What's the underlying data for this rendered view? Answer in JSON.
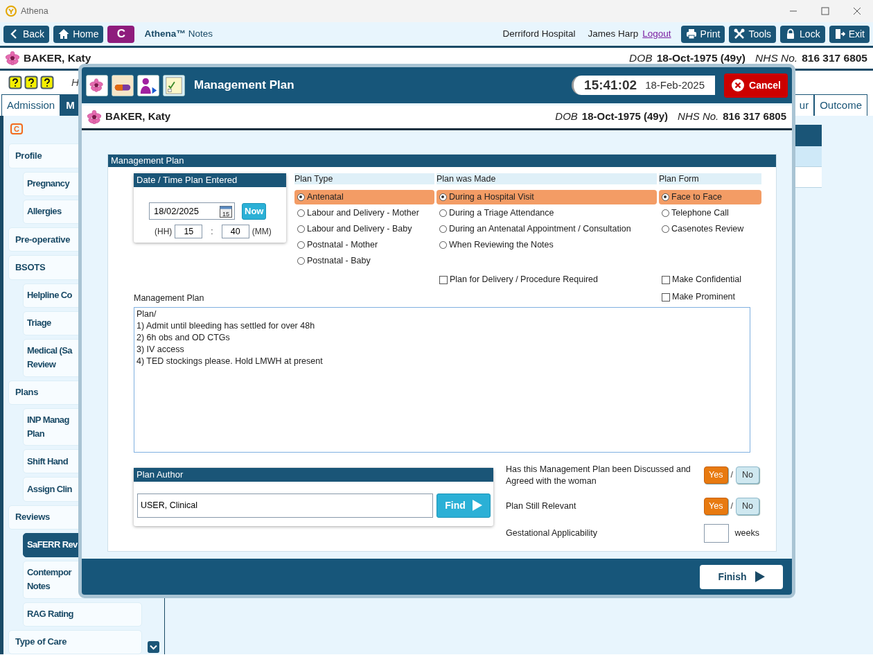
{
  "window": {
    "title": "Athena"
  },
  "toolbar": {
    "left_buttons": [
      {
        "label": "Back"
      },
      {
        "label": "Home"
      }
    ],
    "module_badge": "C",
    "app_name": "Athena™",
    "app_subtitle": "Notes",
    "hospital": "Derriford Hospital",
    "user": "James Harp",
    "logout": "Logout",
    "right_buttons": [
      {
        "label": "Print"
      },
      {
        "label": "Tools"
      },
      {
        "label": "Lock"
      },
      {
        "label": "Exit"
      }
    ]
  },
  "patient": {
    "name": "BAKER, Katy",
    "dob_label": "DOB",
    "dob": "18-Oct-1975 (49y)",
    "nhs_label": "NHS No.",
    "nhs": "816 317 6805"
  },
  "help_row": {
    "text": "H"
  },
  "tabs": [
    {
      "label": "Admission",
      "selected": false
    },
    {
      "label": "M",
      "selected": true
    },
    {
      "label": "ur",
      "selected": false
    },
    {
      "label": "Outcome",
      "selected": false
    }
  ],
  "sidebar": {
    "badge": "C",
    "items": [
      {
        "label": "Profile",
        "selected": false,
        "children": [
          {
            "label": "Pregnancy",
            "selected": false
          },
          {
            "label": "Allergies",
            "selected": false
          }
        ]
      },
      {
        "label": "Pre-operative",
        "selected": false
      },
      {
        "label": "BSOTS",
        "selected": false,
        "children": [
          {
            "label": "Helpline Co",
            "selected": false
          },
          {
            "label": "Triage",
            "selected": false
          },
          {
            "label": "Medical (Sa\nReview",
            "selected": false
          }
        ]
      },
      {
        "label": "Plans",
        "selected": false,
        "children": [
          {
            "label": "INP Manag\nPlan",
            "selected": false
          },
          {
            "label": "Shift Hand",
            "selected": false
          },
          {
            "label": "Assign Clin",
            "selected": false
          }
        ]
      },
      {
        "label": "Reviews",
        "selected": false,
        "children": [
          {
            "label": "SaFERR Rev",
            "selected": true
          },
          {
            "label": "Contempor\nNotes",
            "selected": false
          },
          {
            "label": "RAG Rating",
            "selected": false
          }
        ]
      },
      {
        "label": "Type of Care",
        "selected": false
      }
    ]
  },
  "modal": {
    "title": "Management Plan",
    "time": "15:41:02",
    "date": "18-Feb-2025",
    "cancel": "Cancel",
    "patient": {
      "name": "BAKER, Katy",
      "dob_label": "DOB",
      "dob": "18-Oct-1975 (49y)",
      "nhs_label": "NHS No.",
      "nhs": "816 317 6805"
    },
    "panel_title": "Management Plan",
    "date_box": {
      "title": "Date / Time Plan Entered",
      "date": "18/02/2025",
      "calendar_day": "15",
      "now": "Now",
      "hh_label": "(HH)",
      "hour": "15",
      "separator": ":",
      "minute": "40",
      "mm_label": "(MM)"
    },
    "plan_type": {
      "label": "Plan Type",
      "options": [
        {
          "label": "Antenatal",
          "selected": true
        },
        {
          "label": "Labour and Delivery - Mother",
          "selected": false
        },
        {
          "label": "Labour and Delivery - Baby",
          "selected": false
        },
        {
          "label": "Postnatal - Mother",
          "selected": false
        },
        {
          "label": "Postnatal - Baby",
          "selected": false
        }
      ]
    },
    "plan_made": {
      "label": "Plan was Made",
      "options": [
        {
          "label": "During a Hospital Visit",
          "selected": true
        },
        {
          "label": "During a Triage Attendance",
          "selected": false
        },
        {
          "label": "During an Antenatal Appointment / Consultation",
          "selected": false
        },
        {
          "label": "When Reviewing the Notes",
          "selected": false
        }
      ],
      "checkboxes": [
        {
          "label": "Plan for Delivery / Procedure Required",
          "checked": false
        }
      ]
    },
    "plan_form": {
      "label": "Plan Form",
      "options": [
        {
          "label": "Face to Face",
          "selected": true
        },
        {
          "label": "Telephone Call",
          "selected": false
        },
        {
          "label": "Casenotes Review",
          "selected": false
        }
      ],
      "checkboxes": [
        {
          "label": "Make Confidential",
          "checked": false
        },
        {
          "label": "Make Prominent",
          "checked": false
        }
      ]
    },
    "notes": {
      "label": "Management Plan",
      "value": "Plan/\n1) Admit until bleeding has settled for over 48h\n2) 6h obs and OD CTGs\n3) IV access\n4) TED stockings please. Hold LMWH at present"
    },
    "author": {
      "title": "Plan Author",
      "value": "USER, Clinical",
      "find": "Find"
    },
    "questions": [
      {
        "kind": "yesno",
        "label": "Has this Management Plan been Discussed and Agreed with the woman",
        "separator": "/",
        "options": [
          {
            "label": "Yes",
            "selected": true
          },
          {
            "label": "No",
            "selected": false
          }
        ]
      },
      {
        "kind": "yesno",
        "label": "Plan Still Relevant",
        "separator": "/",
        "options": [
          {
            "label": "Yes",
            "selected": true
          },
          {
            "label": "No",
            "selected": false
          }
        ]
      },
      {
        "kind": "number",
        "label": "Gestational Applicability",
        "unit": "weeks"
      }
    ],
    "finish": "Finish"
  }
}
